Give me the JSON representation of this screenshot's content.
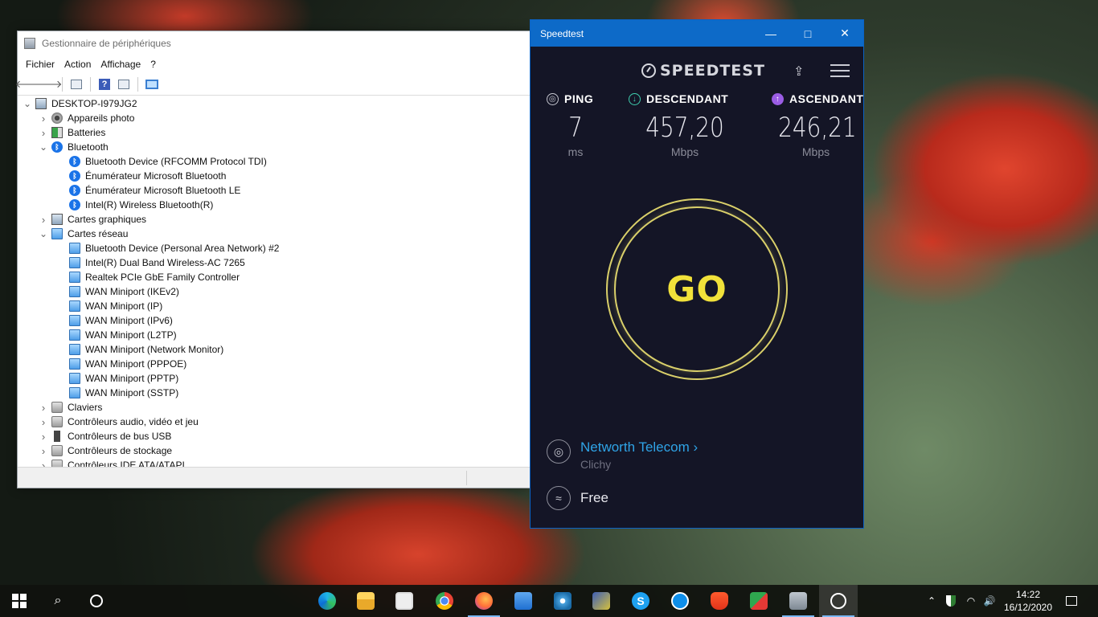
{
  "device_manager": {
    "title": "Gestionnaire de périphériques",
    "menu": [
      "Fichier",
      "Action",
      "Affichage",
      "?"
    ],
    "tree": [
      {
        "level": 0,
        "expanded": true,
        "icon": "computer-icon",
        "label": "DESKTOP-I979JG2"
      },
      {
        "level": 1,
        "expanded": false,
        "icon": "camera-icon",
        "label": "Appareils photo"
      },
      {
        "level": 1,
        "expanded": false,
        "icon": "battery-icon",
        "label": "Batteries"
      },
      {
        "level": 1,
        "expanded": true,
        "icon": "bluetooth-icon",
        "label": "Bluetooth"
      },
      {
        "level": 2,
        "icon": "bluetooth-icon",
        "label": "Bluetooth Device (RFCOMM Protocol TDI)"
      },
      {
        "level": 2,
        "icon": "bluetooth-icon",
        "label": "Énumérateur Microsoft Bluetooth"
      },
      {
        "level": 2,
        "icon": "bluetooth-icon",
        "label": "Énumérateur Microsoft Bluetooth LE"
      },
      {
        "level": 2,
        "icon": "bluetooth-icon",
        "label": "Intel(R) Wireless Bluetooth(R)"
      },
      {
        "level": 1,
        "expanded": false,
        "icon": "display-adapter-icon",
        "label": "Cartes graphiques"
      },
      {
        "level": 1,
        "expanded": true,
        "icon": "network-adapter-icon",
        "label": "Cartes réseau"
      },
      {
        "level": 2,
        "icon": "network-adapter-icon",
        "label": "Bluetooth Device (Personal Area Network) #2"
      },
      {
        "level": 2,
        "icon": "network-adapter-icon",
        "label": "Intel(R) Dual Band Wireless-AC 7265"
      },
      {
        "level": 2,
        "icon": "network-adapter-icon",
        "label": "Realtek PCIe GbE Family Controller"
      },
      {
        "level": 2,
        "icon": "network-adapter-icon",
        "label": "WAN Miniport (IKEv2)"
      },
      {
        "level": 2,
        "icon": "network-adapter-icon",
        "label": "WAN Miniport (IP)"
      },
      {
        "level": 2,
        "icon": "network-adapter-icon",
        "label": "WAN Miniport (IPv6)"
      },
      {
        "level": 2,
        "icon": "network-adapter-icon",
        "label": "WAN Miniport (L2TP)"
      },
      {
        "level": 2,
        "icon": "network-adapter-icon",
        "label": "WAN Miniport (Network Monitor)"
      },
      {
        "level": 2,
        "icon": "network-adapter-icon",
        "label": "WAN Miniport (PPPOE)"
      },
      {
        "level": 2,
        "icon": "network-adapter-icon",
        "label": "WAN Miniport (PPTP)"
      },
      {
        "level": 2,
        "icon": "network-adapter-icon",
        "label": "WAN Miniport (SSTP)"
      },
      {
        "level": 1,
        "expanded": false,
        "icon": "keyboard-icon",
        "label": "Claviers"
      },
      {
        "level": 1,
        "expanded": false,
        "icon": "speaker-icon",
        "label": "Contrôleurs audio, vidéo et jeu"
      },
      {
        "level": 1,
        "expanded": false,
        "icon": "usb-icon",
        "label": "Contrôleurs de bus USB"
      },
      {
        "level": 1,
        "expanded": false,
        "icon": "storage-icon",
        "label": "Contrôleurs de stockage"
      },
      {
        "level": 1,
        "expanded": false,
        "icon": "ide-icon",
        "label": "Contrôleurs IDE ATA/ATAPI"
      }
    ]
  },
  "speedtest": {
    "title": "Speedtest",
    "logo": "SPEEDTEST",
    "ping": {
      "label": "PING",
      "value": "7",
      "unit": "ms"
    },
    "download": {
      "label": "DESCENDANT",
      "value": "457,20",
      "unit": "Mbps"
    },
    "upload": {
      "label": "ASCENDANT",
      "value": "246,21",
      "unit": "Mbps"
    },
    "go_label": "GO",
    "isp_name": "Networth Telecom",
    "isp_location": "Clichy",
    "connection": "Free",
    "colors": {
      "accent": "#2fa4e7",
      "go": "#f1e13a",
      "background": "#141526",
      "titlebar": "#0d6ac8"
    }
  },
  "taskbar": {
    "apps": [
      "edge-icon",
      "file-explorer-icon",
      "store-icon",
      "chrome-icon",
      "firefox-icon",
      "mail-icon",
      "app-icon",
      "app-icon",
      "skype-icon",
      "teamviewer-icon",
      "brave-icon",
      "app-icon",
      "network-icon",
      "speedtest-icon"
    ],
    "time": "14:22",
    "date": "16/12/2020"
  }
}
